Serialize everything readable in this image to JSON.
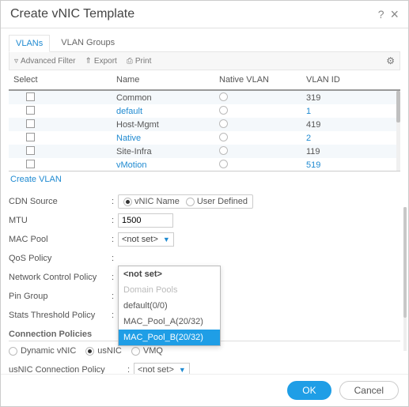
{
  "title": "Create vNIC Template",
  "tabs": {
    "vlans": "VLANs",
    "groups": "VLAN Groups"
  },
  "toolbar": {
    "filter": "Advanced Filter",
    "export": "Export",
    "print": "Print"
  },
  "columns": {
    "select": "Select",
    "name": "Name",
    "native": "Native VLAN",
    "id": "VLAN ID"
  },
  "vlans": [
    {
      "name": "Common",
      "id": "319"
    },
    {
      "name": "default",
      "id": "1",
      "link": true
    },
    {
      "name": "Host-Mgmt",
      "id": "419"
    },
    {
      "name": "Native",
      "id": "2",
      "link": true
    },
    {
      "name": "Site-Infra",
      "id": "119"
    },
    {
      "name": "vMotion",
      "id": "519"
    }
  ],
  "create_vlan": "Create VLAN",
  "form": {
    "cdn_label": "CDN Source",
    "cdn_opts": {
      "vnic": "vNIC Name",
      "user": "User Defined"
    },
    "mtu_label": "MTU",
    "mtu_value": "1500",
    "mac_label": "MAC Pool",
    "mac_value": "<not set>",
    "qos_label": "QoS Policy",
    "ncp_label": "Network Control Policy",
    "pin_label": "Pin Group",
    "stats_label": "Stats Threshold Policy"
  },
  "dropdown": {
    "header": "<not set>",
    "domain": "Domain Pools",
    "default": "default(0/0)",
    "poolA": "MAC_Pool_A(20/32)",
    "poolB": "MAC_Pool_B(20/32)"
  },
  "conn_title": "Connection Policies",
  "conn_opts": {
    "dyn": "Dynamic vNIC",
    "us": "usNIC",
    "vmq": "VMQ"
  },
  "conn_policy_label": "usNIC Connection Policy",
  "conn_policy_value": "<not set>",
  "buttons": {
    "ok": "OK",
    "cancel": "Cancel"
  }
}
